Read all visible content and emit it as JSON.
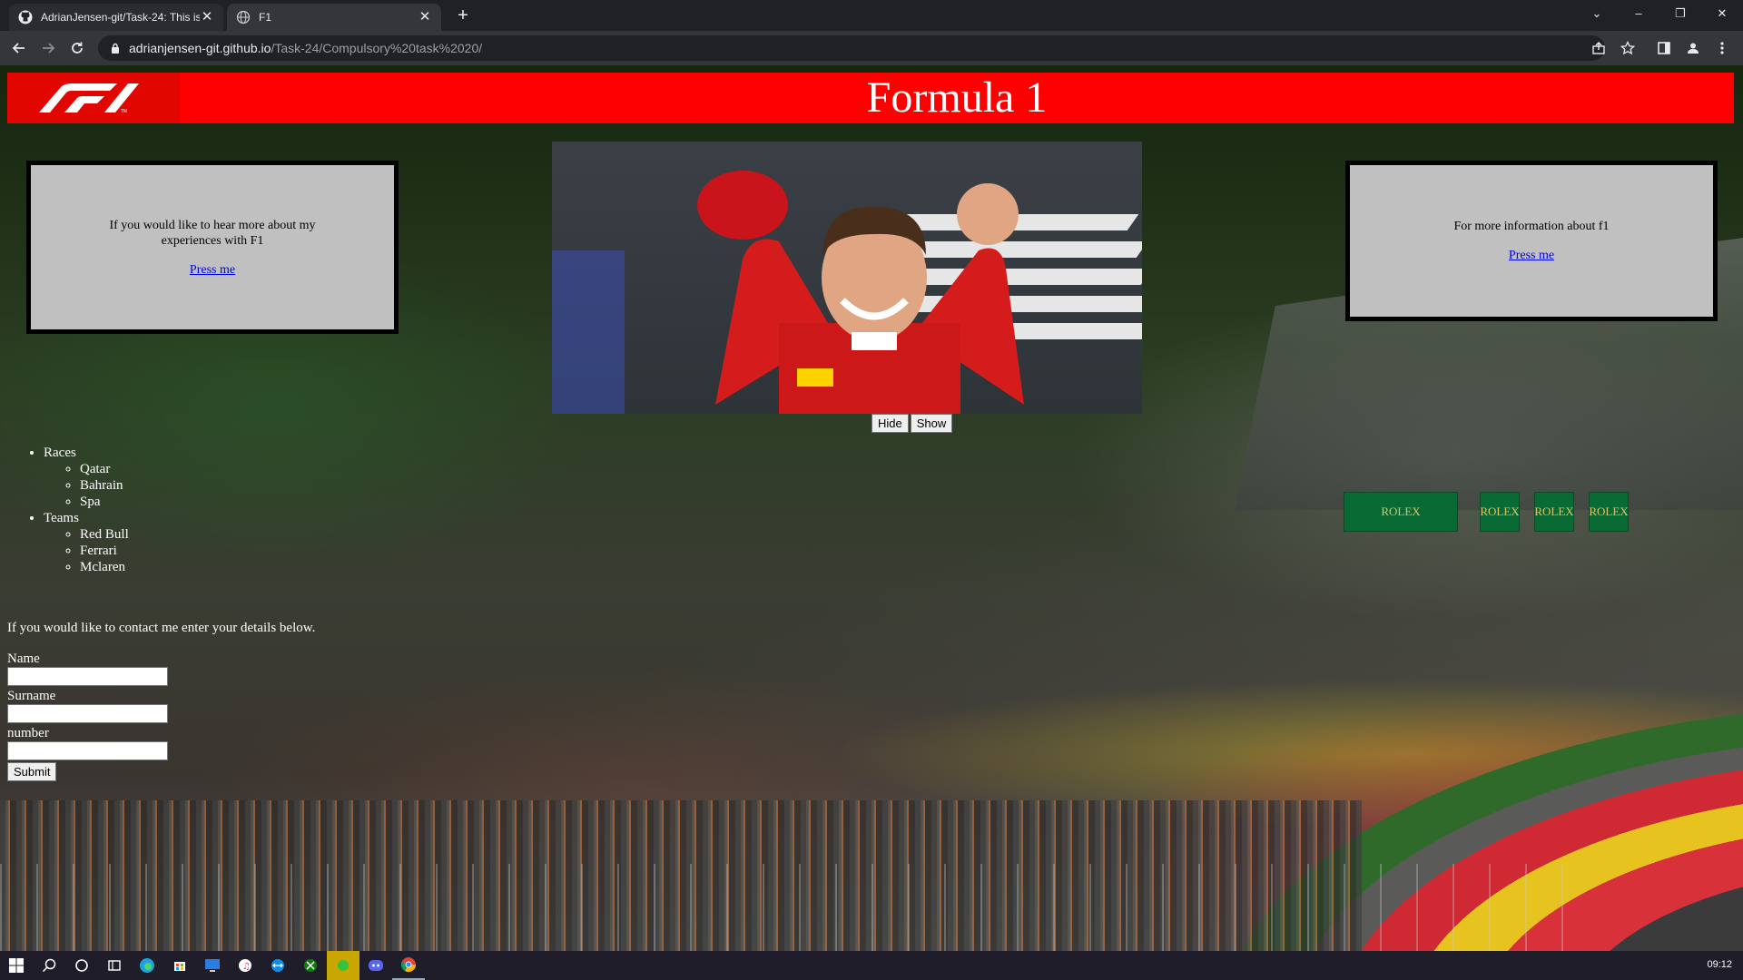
{
  "browser": {
    "tabs": [
      {
        "title": "AdrianJensen-git/Task-24: This is",
        "icon": "github-icon",
        "active": false
      },
      {
        "title": "F1",
        "icon": "globe-icon",
        "active": true
      }
    ],
    "url_host": "adrianjensen-git.github.io",
    "url_path": "/Task-24/Compulsory%20task%2020/"
  },
  "header": {
    "title": "Formula 1",
    "logo": "F1"
  },
  "left_box": {
    "text": "If you would like to hear more about my experiences with F1",
    "link": "Press me"
  },
  "right_box": {
    "text": "For more information about f1",
    "link": "Press me"
  },
  "image_controls": {
    "hide": "Hide",
    "show": "Show"
  },
  "nav": {
    "groups": [
      {
        "label": "Races",
        "items": [
          "Qatar",
          "Bahrain",
          "Spa"
        ]
      },
      {
        "label": "Teams",
        "items": [
          "Red Bull",
          "Ferrari",
          "Mclaren"
        ]
      }
    ]
  },
  "contact": {
    "intro": "If you would like to contact me enter your details below.",
    "name_label": "Name",
    "surname_label": "Surname",
    "number_label": "number",
    "submit": "Submit"
  },
  "background": {
    "banners": [
      "ROLEX",
      "ROLEX",
      "ROLEX",
      "ROLEX"
    ]
  },
  "taskbar": {
    "clock": "09:12"
  },
  "colors": {
    "header_red": "#ff0000",
    "logo_red": "#e10600",
    "box_gray": "#c0c0c0",
    "link_blue": "#0000ee"
  }
}
